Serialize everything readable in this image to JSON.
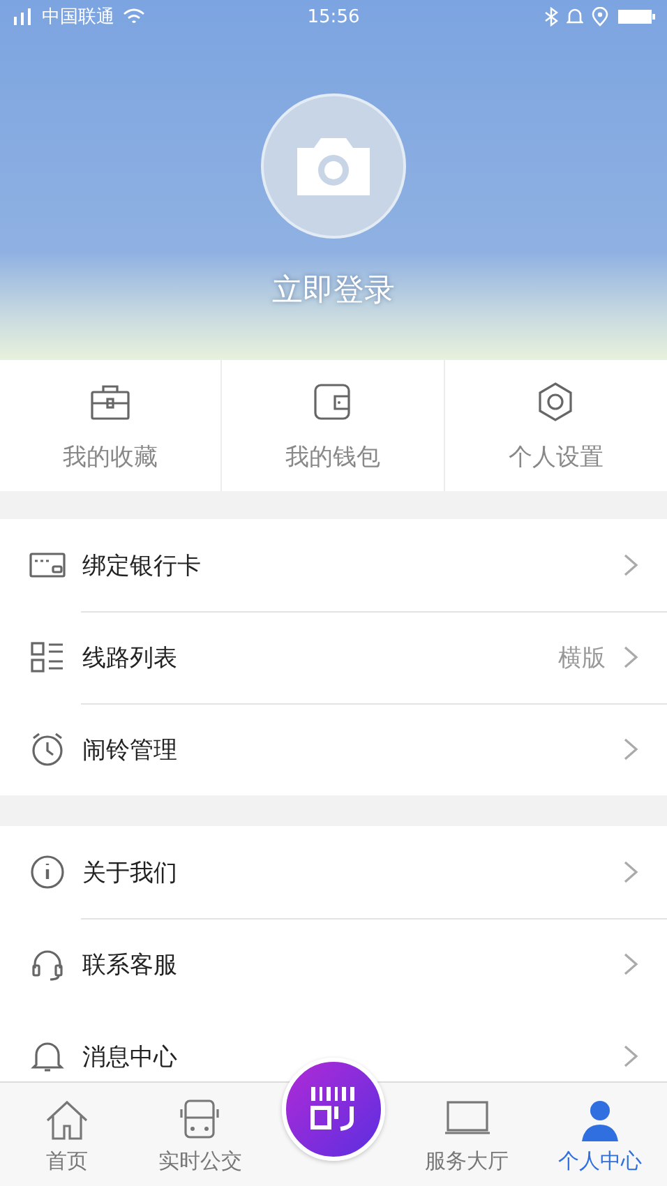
{
  "status_bar": {
    "carrier": "中国联通",
    "time": "15:56"
  },
  "profile": {
    "login_label": "立即登录"
  },
  "quick_actions": [
    {
      "kind": "briefcase",
      "label": "我的收藏"
    },
    {
      "kind": "wallet",
      "label": "我的钱包"
    },
    {
      "kind": "gear",
      "label": "个人设置"
    }
  ],
  "menu_groups": [
    [
      {
        "kind": "card",
        "label": "绑定银行卡"
      },
      {
        "kind": "list",
        "label": "线路列表",
        "value": "横版"
      },
      {
        "kind": "alarm",
        "label": "闹铃管理"
      }
    ],
    [
      {
        "kind": "info",
        "label": "关于我们"
      },
      {
        "kind": "headset",
        "label": "联系客服"
      },
      {
        "kind": "bell",
        "label": "消息中心"
      }
    ]
  ],
  "tab_bar": [
    {
      "kind": "home",
      "label": "首页",
      "selected": false
    },
    {
      "kind": "bus",
      "label": "实时公交",
      "selected": false
    },
    {
      "kind": "scan"
    },
    {
      "kind": "hall",
      "label": "服务大厅",
      "selected": false
    },
    {
      "kind": "person",
      "label": "个人中心",
      "selected": true
    }
  ]
}
